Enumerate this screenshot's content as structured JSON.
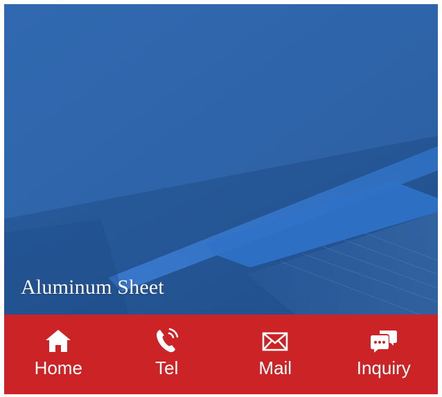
{
  "hero": {
    "caption": "Aluminum Sheet"
  },
  "bottom_nav": {
    "background_color": "#cc2326",
    "items": [
      {
        "label": "Home",
        "icon": "home-icon"
      },
      {
        "label": "Tel",
        "icon": "phone-icon"
      },
      {
        "label": "Mail",
        "icon": "envelope-icon"
      },
      {
        "label": "Inquiry",
        "icon": "chat-icon"
      }
    ]
  }
}
